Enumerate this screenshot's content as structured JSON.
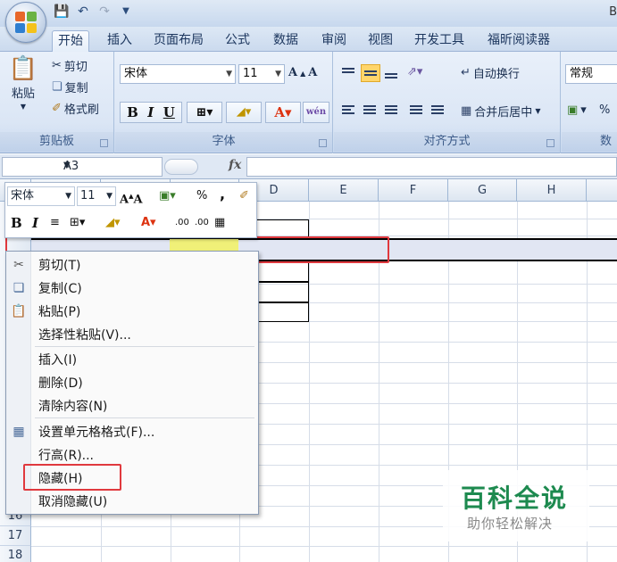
{
  "app": {
    "title_fragment": "B"
  },
  "tabs": [
    "开始",
    "插入",
    "页面布局",
    "公式",
    "数据",
    "审阅",
    "视图",
    "开发工具",
    "福昕阅读器"
  ],
  "active_tab": "开始",
  "ribbon": {
    "clipboard": {
      "paste": "粘贴",
      "cut": "剪切",
      "copy": "复制",
      "format_painter": "格式刷",
      "group": "剪贴板"
    },
    "font": {
      "name": "宋体",
      "size": "11",
      "group": "字体",
      "bold": "B",
      "italic": "I",
      "underline": "U",
      "phonetic": "wén"
    },
    "alignment": {
      "wrap": "自动换行",
      "merge": "合并后居中",
      "group": "对齐方式"
    },
    "number": {
      "format": "常规",
      "group": "数",
      "percent": "%"
    }
  },
  "formula_bar": {
    "name_box": "A3",
    "fx": "fx",
    "formula": ""
  },
  "columns": [
    "D",
    "E",
    "F",
    "G",
    "H"
  ],
  "rows": [
    "16",
    "17",
    "18"
  ],
  "mini_toolbar": {
    "font": "宋体",
    "size": "11",
    "percent": "%",
    "comma": ",",
    "bold": "B",
    "italic": "I"
  },
  "context_menu": [
    {
      "label": "剪切(T)",
      "icon": "scissors-icon"
    },
    {
      "label": "复制(C)",
      "icon": "copy-icon"
    },
    {
      "label": "粘贴(P)",
      "icon": "paste-icon"
    },
    {
      "label": "选择性粘贴(V)...",
      "icon": ""
    },
    {
      "label": "插入(I)",
      "icon": ""
    },
    {
      "label": "删除(D)",
      "icon": ""
    },
    {
      "label": "清除内容(N)",
      "icon": ""
    },
    {
      "label": "设置单元格格式(F)...",
      "icon": "format-cells-icon"
    },
    {
      "label": "行高(R)...",
      "icon": ""
    },
    {
      "label": "隐藏(H)",
      "icon": ""
    },
    {
      "label": "取消隐藏(U)",
      "icon": ""
    }
  ],
  "highlight_color": "#e0393e",
  "watermark": {
    "main": "百科全说",
    "sub": "助你轻松解决"
  }
}
